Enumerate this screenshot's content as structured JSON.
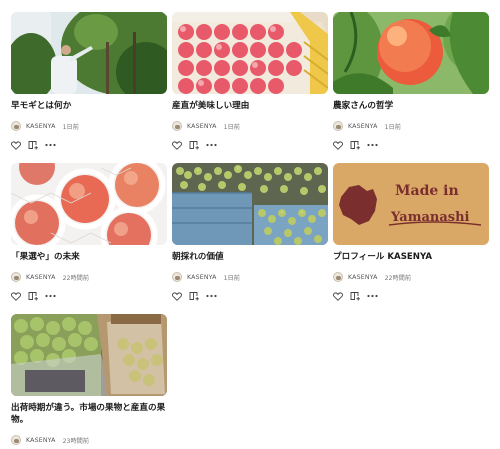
{
  "cards": [
    {
      "title": "早モギとは何か",
      "author": "KASENYA",
      "date": "1日前",
      "image": "photo-farmer-in-tree"
    },
    {
      "title": "産直が美味しい理由",
      "author": "KASENYA",
      "date": "1日前",
      "image": "photo-peaches-in-crate"
    },
    {
      "title": "農家さんの哲学",
      "author": "KASENYA",
      "date": "1日前",
      "image": "photo-peach-on-branch"
    },
    {
      "title": "「果選や」の未来",
      "author": "KASENYA",
      "date": "22時間前",
      "image": "photo-packed-peaches"
    },
    {
      "title": "朝採れの価値",
      "author": "KASENYA",
      "date": "1日前",
      "image": "photo-green-grapes-crates"
    },
    {
      "title": "プロフィール KASENYA",
      "author": "KASENYA",
      "date": "22時間前",
      "image": "logo-made-in-yamanashi",
      "image_text": [
        "Made in",
        "Yamanashi"
      ]
    },
    {
      "title": "出荷時期が違う。市場の果物と産直の果物。",
      "author": "KASENYA",
      "date": "23時間前",
      "image": "photo-grapes-in-bags"
    }
  ],
  "icons": [
    "heart-icon",
    "magazine-add-icon",
    "more-icon"
  ],
  "colors": {
    "text": "#1a1a1a",
    "meta": "#777777",
    "logo_bg": "#d9a866",
    "logo_text": "#7a2e2e"
  }
}
